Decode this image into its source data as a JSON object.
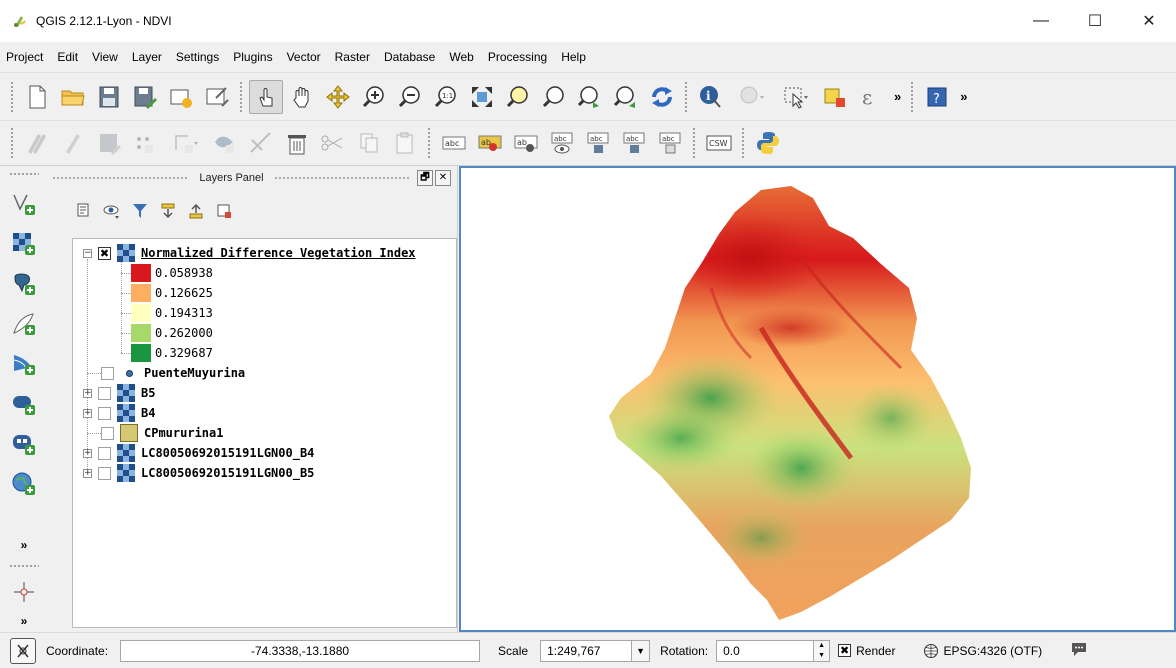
{
  "window": {
    "title": "QGIS 2.12.1-Lyon - NDVI",
    "controls": [
      "—",
      "☐",
      "✕"
    ]
  },
  "menu": [
    "Project",
    "Edit",
    "View",
    "Layer",
    "Settings",
    "Plugins",
    "Vector",
    "Raster",
    "Database",
    "Web",
    "Processing",
    "Help"
  ],
  "toolbar_overflow": "»",
  "digitize_labels": {
    "csw": "CSW",
    "abc": "abc",
    "ab": "ab"
  },
  "layers_panel": {
    "title": "Layers Panel",
    "float_button": "🗗",
    "close_button": "✕",
    "layers": {
      "ndvi": {
        "name": "Normalized Difference Vegetation Index",
        "checked": "✖",
        "legend": [
          {
            "label": "0.058938",
            "color": "#d7191c"
          },
          {
            "label": "0.126625",
            "color": "#fdae61"
          },
          {
            "label": "0.194313",
            "color": "#ffffbf"
          },
          {
            "label": "0.262000",
            "color": "#a6d96a"
          },
          {
            "label": "0.329687",
            "color": "#1a9641"
          }
        ]
      },
      "puente": {
        "name": "PuenteMuyurina"
      },
      "b5": {
        "name": "B5"
      },
      "b4": {
        "name": "B4"
      },
      "cpmururina": {
        "name": "CPmururina1"
      },
      "lc_b4": {
        "name": "LC80050692015191LGN00_B4"
      },
      "lc_b5": {
        "name": "LC80050692015191LGN00_B5"
      }
    }
  },
  "left_toolbar_more": "»",
  "status": {
    "coordinate_label": "Coordinate:",
    "coordinate_value": "-74.3338,-13.1880",
    "scale_label": "Scale",
    "scale_value": "1:249,767",
    "rotation_label": "Rotation:",
    "rotation_value": "0.0",
    "render_label": "Render",
    "render_checked": "✖",
    "crs": "EPSG:4326 (OTF)"
  },
  "colors": {
    "accent_border": "#4f88c2",
    "ndvi_low": "#d7191c",
    "ndvi_high": "#1a9641"
  }
}
